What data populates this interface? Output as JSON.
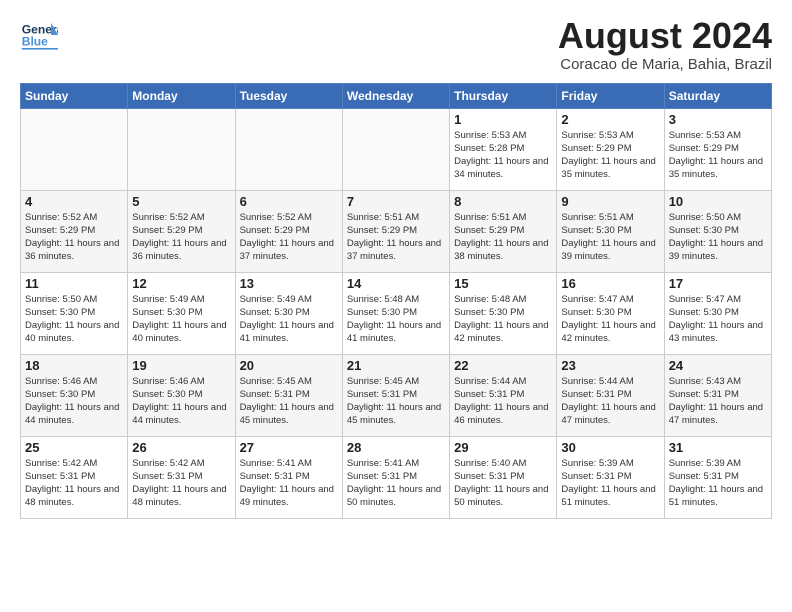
{
  "header": {
    "logo_general": "General",
    "logo_blue": "Blue",
    "month_title": "August 2024",
    "location": "Coracao de Maria, Bahia, Brazil"
  },
  "weekdays": [
    "Sunday",
    "Monday",
    "Tuesday",
    "Wednesday",
    "Thursday",
    "Friday",
    "Saturday"
  ],
  "weeks": [
    [
      {
        "day": "",
        "info": ""
      },
      {
        "day": "",
        "info": ""
      },
      {
        "day": "",
        "info": ""
      },
      {
        "day": "",
        "info": ""
      },
      {
        "day": "1",
        "info": "Sunrise: 5:53 AM\nSunset: 5:28 PM\nDaylight: 11 hours and 34 minutes."
      },
      {
        "day": "2",
        "info": "Sunrise: 5:53 AM\nSunset: 5:29 PM\nDaylight: 11 hours and 35 minutes."
      },
      {
        "day": "3",
        "info": "Sunrise: 5:53 AM\nSunset: 5:29 PM\nDaylight: 11 hours and 35 minutes."
      }
    ],
    [
      {
        "day": "4",
        "info": "Sunrise: 5:52 AM\nSunset: 5:29 PM\nDaylight: 11 hours and 36 minutes."
      },
      {
        "day": "5",
        "info": "Sunrise: 5:52 AM\nSunset: 5:29 PM\nDaylight: 11 hours and 36 minutes."
      },
      {
        "day": "6",
        "info": "Sunrise: 5:52 AM\nSunset: 5:29 PM\nDaylight: 11 hours and 37 minutes."
      },
      {
        "day": "7",
        "info": "Sunrise: 5:51 AM\nSunset: 5:29 PM\nDaylight: 11 hours and 37 minutes."
      },
      {
        "day": "8",
        "info": "Sunrise: 5:51 AM\nSunset: 5:29 PM\nDaylight: 11 hours and 38 minutes."
      },
      {
        "day": "9",
        "info": "Sunrise: 5:51 AM\nSunset: 5:30 PM\nDaylight: 11 hours and 39 minutes."
      },
      {
        "day": "10",
        "info": "Sunrise: 5:50 AM\nSunset: 5:30 PM\nDaylight: 11 hours and 39 minutes."
      }
    ],
    [
      {
        "day": "11",
        "info": "Sunrise: 5:50 AM\nSunset: 5:30 PM\nDaylight: 11 hours and 40 minutes."
      },
      {
        "day": "12",
        "info": "Sunrise: 5:49 AM\nSunset: 5:30 PM\nDaylight: 11 hours and 40 minutes."
      },
      {
        "day": "13",
        "info": "Sunrise: 5:49 AM\nSunset: 5:30 PM\nDaylight: 11 hours and 41 minutes."
      },
      {
        "day": "14",
        "info": "Sunrise: 5:48 AM\nSunset: 5:30 PM\nDaylight: 11 hours and 41 minutes."
      },
      {
        "day": "15",
        "info": "Sunrise: 5:48 AM\nSunset: 5:30 PM\nDaylight: 11 hours and 42 minutes."
      },
      {
        "day": "16",
        "info": "Sunrise: 5:47 AM\nSunset: 5:30 PM\nDaylight: 11 hours and 42 minutes."
      },
      {
        "day": "17",
        "info": "Sunrise: 5:47 AM\nSunset: 5:30 PM\nDaylight: 11 hours and 43 minutes."
      }
    ],
    [
      {
        "day": "18",
        "info": "Sunrise: 5:46 AM\nSunset: 5:30 PM\nDaylight: 11 hours and 44 minutes."
      },
      {
        "day": "19",
        "info": "Sunrise: 5:46 AM\nSunset: 5:30 PM\nDaylight: 11 hours and 44 minutes."
      },
      {
        "day": "20",
        "info": "Sunrise: 5:45 AM\nSunset: 5:31 PM\nDaylight: 11 hours and 45 minutes."
      },
      {
        "day": "21",
        "info": "Sunrise: 5:45 AM\nSunset: 5:31 PM\nDaylight: 11 hours and 45 minutes."
      },
      {
        "day": "22",
        "info": "Sunrise: 5:44 AM\nSunset: 5:31 PM\nDaylight: 11 hours and 46 minutes."
      },
      {
        "day": "23",
        "info": "Sunrise: 5:44 AM\nSunset: 5:31 PM\nDaylight: 11 hours and 47 minutes."
      },
      {
        "day": "24",
        "info": "Sunrise: 5:43 AM\nSunset: 5:31 PM\nDaylight: 11 hours and 47 minutes."
      }
    ],
    [
      {
        "day": "25",
        "info": "Sunrise: 5:42 AM\nSunset: 5:31 PM\nDaylight: 11 hours and 48 minutes."
      },
      {
        "day": "26",
        "info": "Sunrise: 5:42 AM\nSunset: 5:31 PM\nDaylight: 11 hours and 48 minutes."
      },
      {
        "day": "27",
        "info": "Sunrise: 5:41 AM\nSunset: 5:31 PM\nDaylight: 11 hours and 49 minutes."
      },
      {
        "day": "28",
        "info": "Sunrise: 5:41 AM\nSunset: 5:31 PM\nDaylight: 11 hours and 50 minutes."
      },
      {
        "day": "29",
        "info": "Sunrise: 5:40 AM\nSunset: 5:31 PM\nDaylight: 11 hours and 50 minutes."
      },
      {
        "day": "30",
        "info": "Sunrise: 5:39 AM\nSunset: 5:31 PM\nDaylight: 11 hours and 51 minutes."
      },
      {
        "day": "31",
        "info": "Sunrise: 5:39 AM\nSunset: 5:31 PM\nDaylight: 11 hours and 51 minutes."
      }
    ]
  ]
}
